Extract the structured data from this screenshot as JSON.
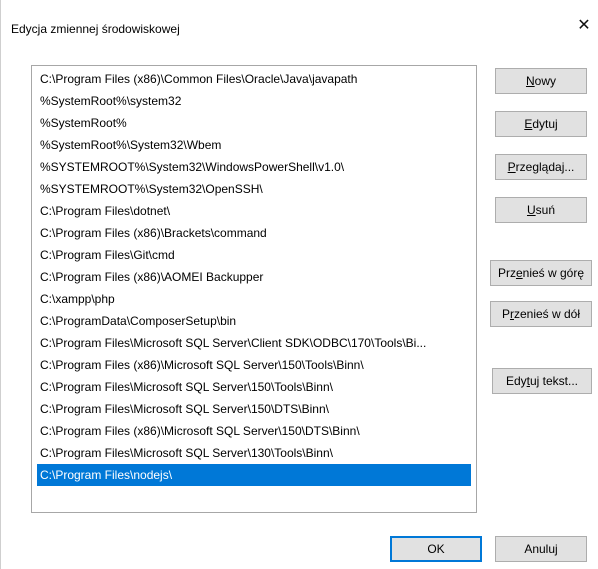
{
  "window": {
    "title": "Edycja zmiennej środowiskowej",
    "close_label": "✕"
  },
  "list": {
    "items": [
      "C:\\Program Files (x86)\\Common Files\\Oracle\\Java\\javapath",
      "%SystemRoot%\\system32",
      "%SystemRoot%",
      "%SystemRoot%\\System32\\Wbem",
      "%SYSTEMROOT%\\System32\\WindowsPowerShell\\v1.0\\",
      "%SYSTEMROOT%\\System32\\OpenSSH\\",
      "C:\\Program Files\\dotnet\\",
      "C:\\Program Files (x86)\\Brackets\\command",
      "C:\\Program Files\\Git\\cmd",
      "C:\\Program Files (x86)\\AOMEI Backupper",
      "C:\\xampp\\php",
      "C:\\ProgramData\\ComposerSetup\\bin",
      "C:\\Program Files\\Microsoft SQL Server\\Client SDK\\ODBC\\170\\Tools\\Bi...",
      "C:\\Program Files (x86)\\Microsoft SQL Server\\150\\Tools\\Binn\\",
      "C:\\Program Files\\Microsoft SQL Server\\150\\Tools\\Binn\\",
      "C:\\Program Files\\Microsoft SQL Server\\150\\DTS\\Binn\\",
      "C:\\Program Files (x86)\\Microsoft SQL Server\\150\\DTS\\Binn\\",
      "C:\\Program Files\\Microsoft SQL Server\\130\\Tools\\Binn\\",
      "C:\\Program Files\\nodejs\\"
    ],
    "selected_index": 18
  },
  "buttons": {
    "new": {
      "key": "N",
      "rest": "owy"
    },
    "edit": {
      "key": "E",
      "rest": "dytuj"
    },
    "browse": {
      "pre": "",
      "key": "P",
      "rest": "rzeglądaj..."
    },
    "delete": {
      "pre": "",
      "key": "U",
      "rest": "suń"
    },
    "move_up": {
      "pre": "Prz",
      "key": "e",
      "rest": "nieś w górę"
    },
    "move_down": {
      "pre": "P",
      "key": "r",
      "rest": "zenieś w dół"
    },
    "edit_text": {
      "pre": "Edy",
      "key": "t",
      "rest": "uj tekst..."
    },
    "ok": "OK",
    "cancel": "Anuluj"
  },
  "colors": {
    "selection": "#0078d7",
    "button_face": "#e1e1e1"
  }
}
